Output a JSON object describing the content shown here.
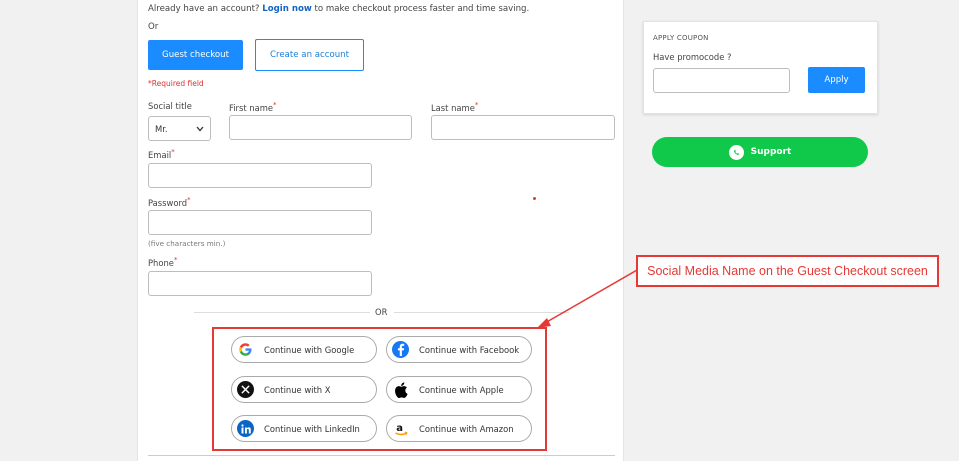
{
  "checkout": {
    "intro_prefix": "Already have an account?",
    "intro_link": "Login now",
    "intro_suffix": "to make checkout process faster and time saving.",
    "or_text": "Or",
    "guest_button": "Guest checkout",
    "create_button": "Create an account",
    "required_note": "*Required field",
    "social_title_label": "Social title",
    "social_title_value": "Mr.",
    "first_name_label": "First name",
    "last_name_label": "Last name",
    "email_label": "Email",
    "password_label": "Password",
    "password_hint": "(five characters min.)",
    "phone_label": "Phone",
    "required_mark": "*",
    "divider_or": "OR"
  },
  "social": [
    {
      "label": "Continue with Google",
      "icon": "google-icon"
    },
    {
      "label": "Continue with Facebook",
      "icon": "facebook-icon"
    },
    {
      "label": "Continue with X",
      "icon": "x-icon"
    },
    {
      "label": "Continue with Apple",
      "icon": "apple-icon"
    },
    {
      "label": "Continue with LinkedIn",
      "icon": "linkedin-icon"
    },
    {
      "label": "Continue with Amazon",
      "icon": "amazon-icon"
    }
  ],
  "coupon": {
    "title": "APPLY COUPON",
    "question": "Have promocode ?",
    "apply_button": "Apply"
  },
  "support": {
    "label": "Support",
    "icon": "whatsapp-icon"
  },
  "annotation": {
    "callout_text": "Social Media Name on the Guest Checkout screen",
    "color": "#e53935"
  },
  "colors": {
    "primary": "#1a8cff",
    "support_green": "#10c84a",
    "required_red": "#e03030"
  }
}
